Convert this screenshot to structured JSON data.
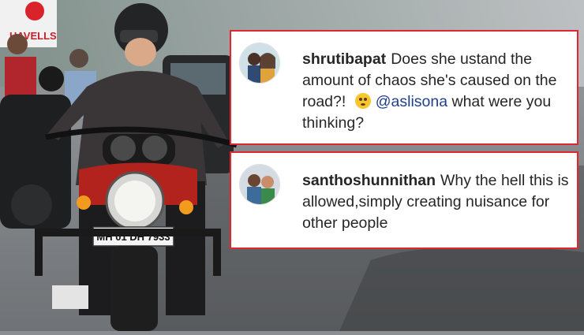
{
  "photo": {
    "shop_sign": "HAVELLS",
    "number_plate": "MH 01 DH 7933"
  },
  "comments": [
    {
      "username": "shrutibapat",
      "text_before": "Does she ustand the amount of chaos she's caused on the road?!",
      "emoji": "flushed-face",
      "mention": "@aslisona",
      "text_after": "what were you thinking?"
    },
    {
      "username": "santhoshunnithan",
      "text": "Why the hell this is allowed,simply creating nuisance for other people"
    }
  ],
  "colors": {
    "card_border": "#e0262f",
    "mention": "#1f3f8f",
    "comment_text": "#262626"
  }
}
